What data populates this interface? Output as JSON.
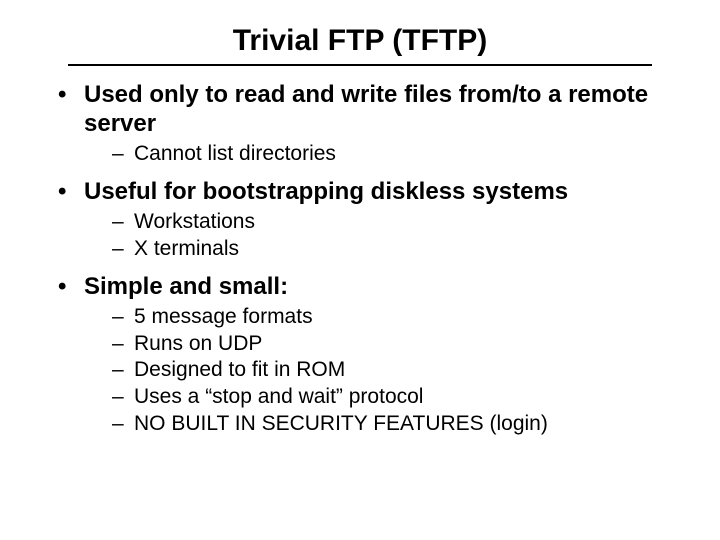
{
  "title": "Trivial FTP (TFTP)",
  "bullets": [
    {
      "text": "Used only to read and write files from/to a remote server",
      "sub": [
        "Cannot list directories"
      ]
    },
    {
      "text": "Useful for bootstrapping diskless systems",
      "sub": [
        "Workstations",
        "X terminals"
      ]
    },
    {
      "text": "Simple and small:",
      "sub": [
        "5 message formats",
        "Runs on UDP",
        "Designed to fit in ROM",
        "Uses a “stop and wait” protocol",
        "NO BUILT IN SECURITY FEATURES (login)"
      ]
    }
  ]
}
